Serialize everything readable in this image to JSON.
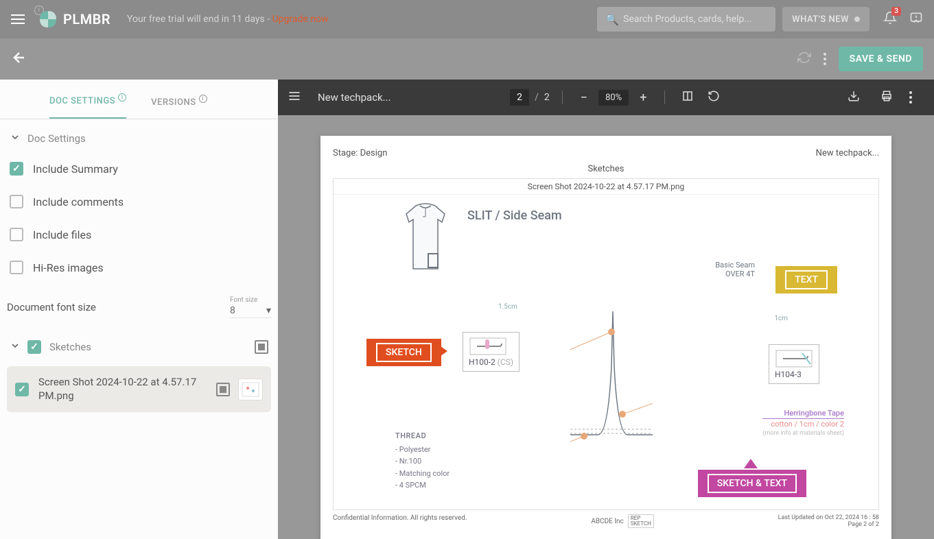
{
  "header": {
    "brand": "PLMBR",
    "trial_prefix": "Your free trial will end in 11 days ",
    "trial_sep": "- ",
    "upgrade": "Upgrade now",
    "search_placeholder": "Search Products, cards, help...",
    "whats_new": "WHAT'S NEW",
    "notification_count": "3"
  },
  "subheader": {
    "save_send": "SAVE & SEND"
  },
  "sidebar": {
    "tabs": {
      "doc_settings": "DOC SETTINGS",
      "versions": "VERSIONS"
    },
    "sections": {
      "doc_settings_hdr": "Doc Settings"
    },
    "checks": {
      "include_summary": "Include Summary",
      "include_comments": "Include comments",
      "include_files": "Include files",
      "hires": "Hi-Res images"
    },
    "font_size_label": "Document font size",
    "font_size_field": "Font size",
    "font_size_value": "8",
    "sketches_label": "Sketches",
    "file_name": "Screen Shot 2024-10-22 at 4.57.17 PM.png"
  },
  "pdf": {
    "title": "New techpack...",
    "current_page": "2",
    "total_pages": "2",
    "zoom": "80%"
  },
  "page": {
    "stage": "Stage: Design",
    "tp_name": "New techpack...",
    "section": "Sketches",
    "image_name": "Screen Shot 2024-10-22 at 4.57.17 PM.png",
    "slit_title": "SLIT / Side Seam",
    "seam_text1": "Basic Seam",
    "seam_text2": "OVER 4T",
    "dim1": "1.5cm",
    "dim2": "1cm",
    "code1": "H100-2",
    "code1_suffix": "(CS)",
    "code2": "H104-3",
    "herring_name": "Herringbone Tape",
    "herring_info": "cotton / 1cm / color 2",
    "herring_more": "(more info at materials sheet)",
    "thread_hdr": "THREAD",
    "thread_1": "- Polyester",
    "thread_2": "- Nr.100",
    "thread_3": "- Matching color",
    "thread_4": "- 4 SPCM",
    "annot_sketch": "SKETCH",
    "annot_text": "TEXT",
    "annot_st": "SKETCH & TEXT",
    "footer_left": "Confidential Information. All rights reserved.",
    "footer_center": "ABCDE Inc",
    "footer_rep1": "REP",
    "footer_rep2": "SKETCH",
    "footer_updated": "Last Updated on Oct 22, 2024 16 : 58",
    "footer_page": "Page 2 of 2"
  }
}
